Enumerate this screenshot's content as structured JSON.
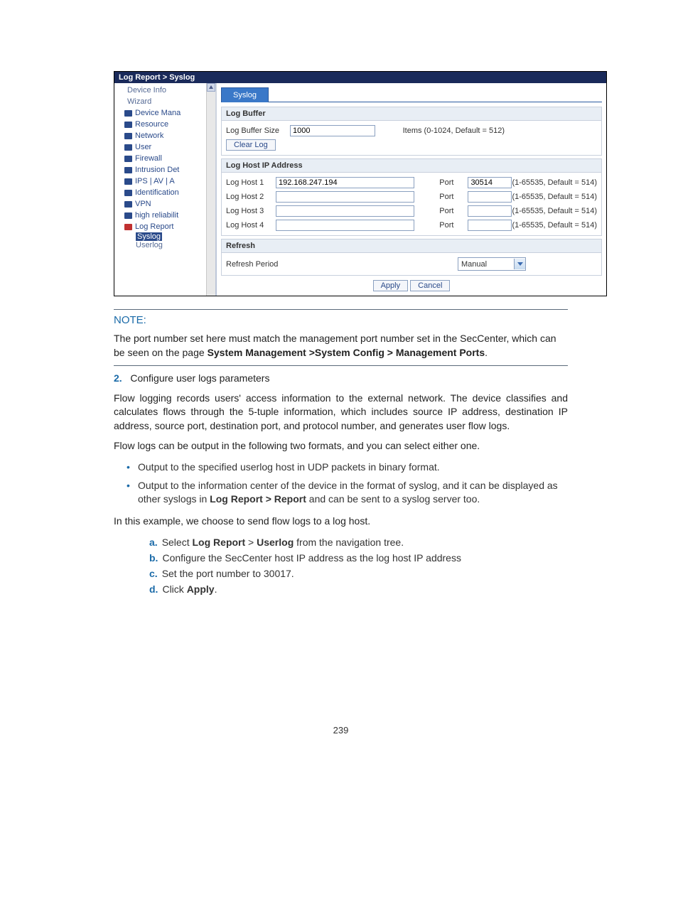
{
  "breadcrumb": "Log Report > Syslog",
  "sidebar": {
    "items": [
      {
        "label": "Device Info",
        "folder": false
      },
      {
        "label": "Wizard",
        "folder": false
      },
      {
        "label": "Device Mana",
        "folder": true
      },
      {
        "label": "Resource",
        "folder": true
      },
      {
        "label": "Network",
        "folder": true
      },
      {
        "label": "User",
        "folder": true
      },
      {
        "label": "Firewall",
        "folder": true
      },
      {
        "label": "Intrusion Det",
        "folder": true
      },
      {
        "label": "IPS | AV | A",
        "folder": true
      },
      {
        "label": "Identification",
        "folder": true
      },
      {
        "label": "VPN",
        "folder": true
      },
      {
        "label": "high reliabilit",
        "folder": true
      },
      {
        "label": "Log Report",
        "folder": true,
        "red": true
      }
    ],
    "sub": [
      {
        "label": "Syslog",
        "selected": true
      },
      {
        "label": "Userlog",
        "selected": false
      }
    ]
  },
  "tab_label": "Syslog",
  "log_buffer": {
    "header": "Log Buffer",
    "size_label": "Log Buffer Size",
    "size_value": "1000",
    "size_hint": "Items (0-1024, Default = 512)",
    "clear_label": "Clear Log"
  },
  "log_host": {
    "header": "Log Host IP Address",
    "rows": [
      {
        "label": "Log Host 1",
        "ip": "192.168.247.194",
        "port_label": "Port",
        "port": "30514",
        "hint": "(1-65535, Default = 514)"
      },
      {
        "label": "Log Host 2",
        "ip": "",
        "port_label": "Port",
        "port": "",
        "hint": "(1-65535, Default = 514)"
      },
      {
        "label": "Log Host 3",
        "ip": "",
        "port_label": "Port",
        "port": "",
        "hint": "(1-65535, Default = 514)"
      },
      {
        "label": "Log Host 4",
        "ip": "",
        "port_label": "Port",
        "port": "",
        "hint": "(1-65535, Default = 514)"
      }
    ]
  },
  "refresh": {
    "header": "Refresh",
    "period_label": "Refresh Period",
    "value": "Manual"
  },
  "apply_label": "Apply",
  "cancel_label": "Cancel",
  "note": {
    "title": "NOTE:",
    "body_pre": "The port number set here must match the management port number set in the SecCenter, which can be seen on the page ",
    "body_bold": "System Management >System Config > Management Ports",
    "body_post": "."
  },
  "step2": {
    "num": "2.",
    "title": "Configure user logs parameters",
    "p1": "Flow logging records users' access information to the external network. The device classifies and calculates flows through the 5-tuple information, which includes source IP address, destination IP address, source port, destination port, and protocol number, and generates user flow logs.",
    "p2": "Flow logs can be output in the following two formats, and you can select either one.",
    "bullets": [
      "Output to the specified userlog host in UDP packets in binary format.",
      "Output to the information center of the device in the format of syslog, and it can be displayed as other syslogs in Log Report > Report and can be sent to a syslog server too."
    ],
    "p3": "In this example, we choose to send flow logs to a log host.",
    "sub": [
      {
        "let": "a.",
        "pre": "Select ",
        "b1": "Log Report",
        "mid": " > ",
        "b2": "Userlog",
        "post": " from the navigation tree."
      },
      {
        "let": "b.",
        "text": "Configure the SecCenter host  IP address as the log host IP address"
      },
      {
        "let": "c.",
        "text": "Set the port number to 30017."
      },
      {
        "let": "d.",
        "pre": "Click ",
        "b1": "Apply",
        "post": "."
      }
    ]
  },
  "page_number": "239"
}
